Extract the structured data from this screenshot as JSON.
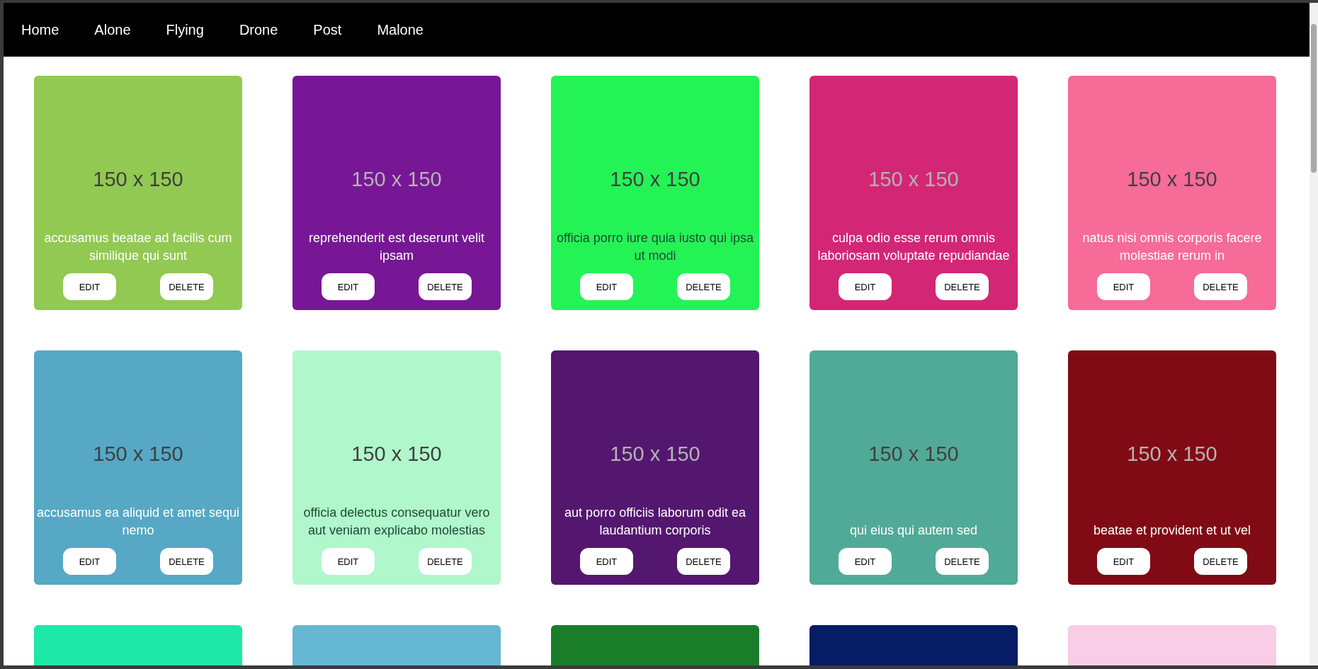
{
  "nav": {
    "links": [
      "Home",
      "Alone",
      "Flying",
      "Drone",
      "Post",
      "Malone"
    ]
  },
  "cards": [
    {
      "color": "#92c952",
      "image_text": "150 x 150",
      "title": "accusamus beatae ad facilis cum similique qui sunt",
      "buttons": [
        "EDIT",
        "DELETE"
      ]
    },
    {
      "color": "#771796",
      "image_text": "150 x 150",
      "title": "reprehenderit est deserunt velit ipsam",
      "buttons": [
        "EDIT",
        "DELETE"
      ]
    },
    {
      "color": "#24f355",
      "image_text": "150 x 150",
      "title": "officia porro iure quia iusto qui ipsa ut modi",
      "buttons": [
        "EDIT",
        "DELETE"
      ]
    },
    {
      "color": "#d32776",
      "image_text": "150 x 150",
      "title": "culpa odio esse rerum omnis laboriosam voluptate repudiandae",
      "buttons": [
        "EDIT",
        "DELETE"
      ]
    },
    {
      "color": "#f66b97",
      "image_text": "150 x 150",
      "title": "natus nisi omnis corporis facere molestiae rerum in",
      "buttons": [
        "EDIT",
        "DELETE"
      ]
    },
    {
      "color": "#56a8c5",
      "image_text": "150 x 150",
      "title": "accusamus ea aliquid et amet sequi nemo",
      "buttons": [
        "EDIT",
        "DELETE"
      ]
    },
    {
      "color": "#b0f7cc",
      "image_text": "150 x 150",
      "title": "officia delectus consequatur vero aut veniam explicabo molestias",
      "buttons": [
        "EDIT",
        "DELETE"
      ]
    },
    {
      "color": "#54176f",
      "image_text": "150 x 150",
      "title": "aut porro officiis laborum odit ea laudantium corporis",
      "buttons": [
        "EDIT",
        "DELETE"
      ]
    },
    {
      "color": "#51aa97",
      "image_text": "150 x 150",
      "title": "qui eius qui autem sed",
      "buttons": [
        "EDIT",
        "DELETE"
      ]
    },
    {
      "color": "#810b14",
      "image_text": "150 x 150",
      "title": "beatae et provident et ut vel",
      "buttons": [
        "EDIT",
        "DELETE"
      ]
    },
    {
      "color": "#1ee8a8"
    },
    {
      "color": "#66b7d2"
    },
    {
      "color": "#197d29"
    },
    {
      "color": "#061c64"
    },
    {
      "color": "#f9cde5"
    }
  ]
}
